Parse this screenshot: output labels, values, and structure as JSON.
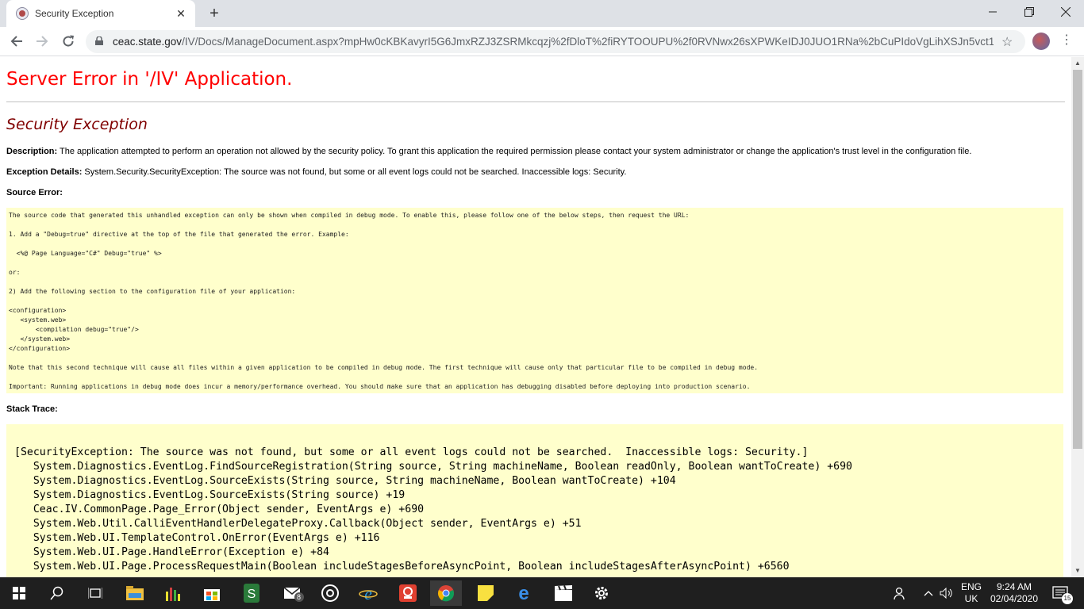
{
  "browser": {
    "tab_title": "Security Exception",
    "url_host": "ceac.state.gov",
    "url_rest": "/IV/Docs/ManageDocument.aspx?mpHw0cKBKavyrI5G6JmxRZJ3ZSRMkcqzj%2fDloT%2fiRYTOOUPU%2f0RVNwx26sXPWKeIDJ0JUO1RNa%2bCuPIdoVgLihXSJn5vct1..."
  },
  "page": {
    "heading": "Server Error in '/IV' Application.",
    "subheading": "Security Exception",
    "description_label": "Description:",
    "description_text": " The application attempted to perform an operation not allowed by the security policy.  To grant this application the required permission please contact your system administrator or change the application's trust level in the configuration file.",
    "exception_label": "Exception Details:",
    "exception_text": " System.Security.SecurityException: The source was not found, but some or all event logs could not be searched.  Inaccessible logs: Security.",
    "source_error_label": "Source Error:",
    "stack_trace_label": "Stack Trace:",
    "source_lines": [
      "The source code that generated this unhandled exception can only be shown when compiled in debug mode. To enable this, please follow one of the below steps, then request the URL:",
      "1. Add a \"Debug=true\" directive at the top of the file that generated the error. Example:",
      "  <%@ Page Language=\"C#\" Debug=\"true\" %>",
      "or:",
      "2) Add the following section to the configuration file of your application:",
      "<configuration>",
      "   <system.web>",
      "       <compilation debug=\"true\"/>",
      "   </system.web>",
      "</configuration>",
      "Note that this second technique will cause all files within a given application to be compiled in debug mode. The first technique will cause only that particular file to be compiled in debug mode.",
      "Important: Running applications in debug mode does incur a memory/performance overhead. You should make sure that an application has debugging disabled before deploying into production scenario."
    ],
    "stack_lines": [
      "[SecurityException: The source was not found, but some or all event logs could not be searched.  Inaccessible logs: Security.]",
      "   System.Diagnostics.EventLog.FindSourceRegistration(String source, String machineName, Boolean readOnly, Boolean wantToCreate) +690",
      "   System.Diagnostics.EventLog.SourceExists(String source, String machineName, Boolean wantToCreate) +104",
      "   System.Diagnostics.EventLog.SourceExists(String source) +19",
      "   Ceac.IV.CommonPage.Page_Error(Object sender, EventArgs e) +690",
      "   System.Web.Util.CalliEventHandlerDelegateProxy.Callback(Object sender, EventArgs e) +51",
      "   System.Web.UI.TemplateControl.OnError(EventArgs e) +116",
      "   System.Web.UI.Page.HandleError(Exception e) +84",
      "   System.Web.UI.Page.ProcessRequestMain(Boolean includeStagesBeforeAsyncPoint, Boolean includeStagesAfterAsyncPoint) +6560"
    ]
  },
  "taskbar": {
    "mail_badge": "8",
    "lang_top": "ENG",
    "lang_bottom": "UK",
    "time": "9:24 AM",
    "date": "02/04/2020",
    "notif_count": "15"
  }
}
